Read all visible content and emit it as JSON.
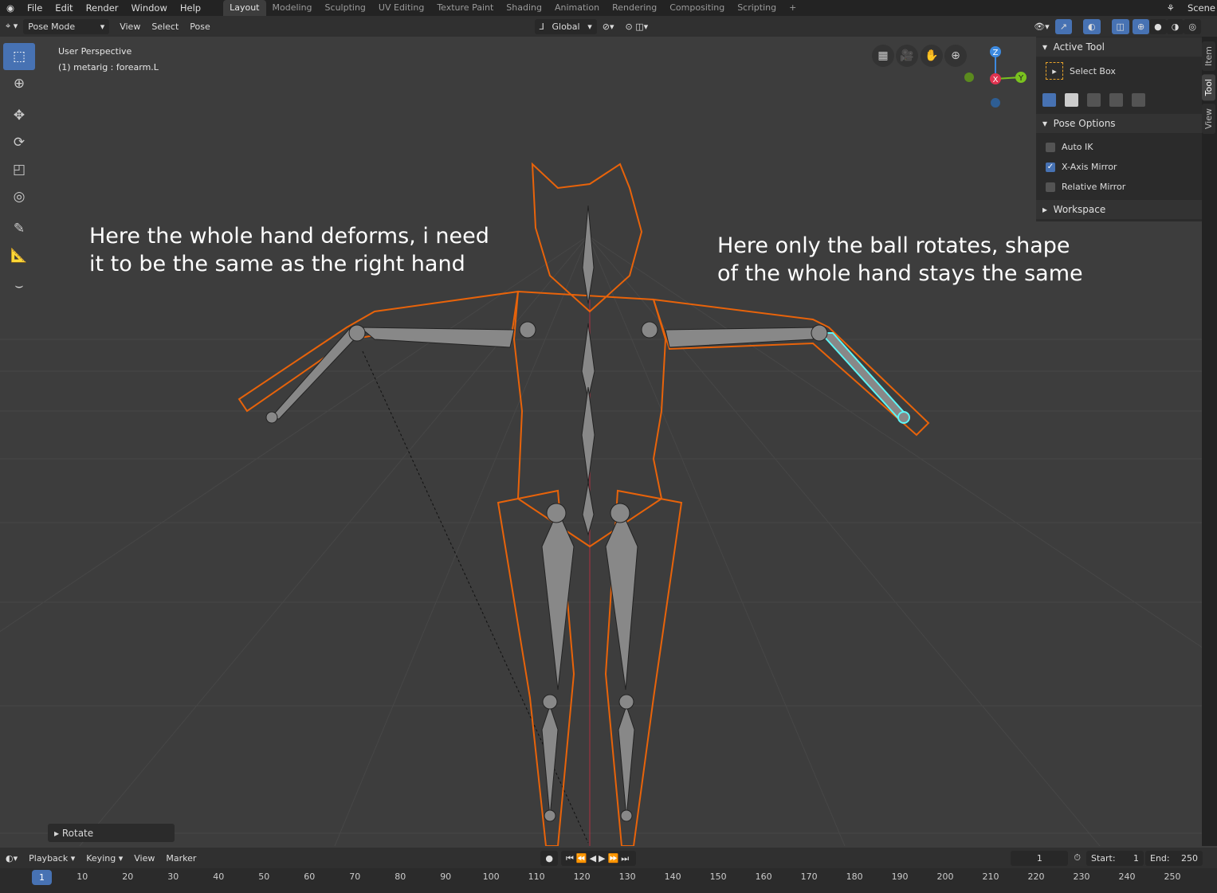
{
  "topbar": {
    "menus": [
      "File",
      "Edit",
      "Render",
      "Window",
      "Help"
    ],
    "tabs": [
      "Layout",
      "Modeling",
      "Sculpting",
      "UV Editing",
      "Texture Paint",
      "Shading",
      "Animation",
      "Rendering",
      "Compositing",
      "Scripting"
    ],
    "active_tab": "Layout",
    "add_tab": "+",
    "scene": "Scene"
  },
  "header": {
    "mode": "Pose Mode",
    "menus": [
      "View",
      "Select",
      "Pose"
    ],
    "orientation": "Global"
  },
  "viewport": {
    "perspective": "User Perspective",
    "object": "(1) metarig : forearm.L",
    "annotation_left": [
      "Here the whole hand deforms, i need",
      "it to be the same as the right hand"
    ],
    "annotation_right": [
      "Here only the ball rotates, shape",
      "of the whole hand stays the same"
    ],
    "gizmo": {
      "z": "Z",
      "x": "X",
      "y": "Y"
    },
    "operator_panel": "Rotate"
  },
  "npanel": {
    "tabs": [
      "Item",
      "Tool",
      "View"
    ],
    "active_tab": "Tool",
    "active_tool": {
      "title": "Active Tool",
      "tool": "Select Box"
    },
    "pose_options": {
      "title": "Pose Options",
      "options": [
        {
          "label": "Auto IK",
          "checked": false
        },
        {
          "label": "X-Axis Mirror",
          "checked": true
        },
        {
          "label": "Relative Mirror",
          "checked": false
        }
      ]
    },
    "workspace": "Workspace"
  },
  "timeline": {
    "menus": [
      "Playback",
      "Keying",
      "View",
      "Marker"
    ],
    "current_frame": "1",
    "start_label": "Start:",
    "start": "1",
    "end_label": "End:",
    "end": "250",
    "ticks": [
      "1",
      "10",
      "20",
      "30",
      "40",
      "50",
      "60",
      "70",
      "80",
      "90",
      "100",
      "110",
      "120",
      "130",
      "140",
      "150",
      "160",
      "170",
      "180",
      "190",
      "200",
      "210",
      "220",
      "230",
      "240",
      "250"
    ]
  },
  "colors": {
    "accent": "#4772b3",
    "selection": "#e8630a",
    "active_bone": "#5ff5f5"
  }
}
